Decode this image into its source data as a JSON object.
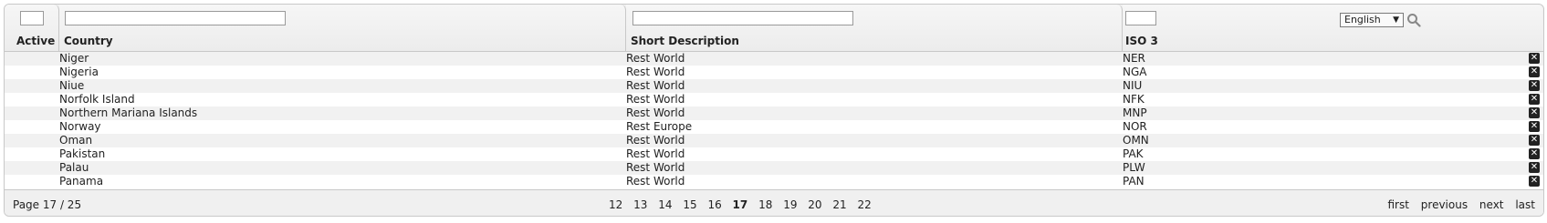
{
  "header": {
    "columns": {
      "active": "Active",
      "country": "Country",
      "short_description": "Short Description",
      "iso3": "ISO 3"
    },
    "language": "English"
  },
  "rows": [
    {
      "country": "Niger",
      "short_description": "Rest World",
      "iso3": "NER"
    },
    {
      "country": "Nigeria",
      "short_description": "Rest World",
      "iso3": "NGA"
    },
    {
      "country": "Niue",
      "short_description": "Rest World",
      "iso3": "NIU"
    },
    {
      "country": "Norfolk Island",
      "short_description": "Rest World",
      "iso3": "NFK"
    },
    {
      "country": "Northern Mariana Islands",
      "short_description": "Rest World",
      "iso3": "MNP"
    },
    {
      "country": "Norway",
      "short_description": "Rest Europe",
      "iso3": "NOR"
    },
    {
      "country": "Oman",
      "short_description": "Rest World",
      "iso3": "OMN"
    },
    {
      "country": "Pakistan",
      "short_description": "Rest World",
      "iso3": "PAK"
    },
    {
      "country": "Palau",
      "short_description": "Rest World",
      "iso3": "PLW"
    },
    {
      "country": "Panama",
      "short_description": "Rest World",
      "iso3": "PAN"
    }
  ],
  "footer": {
    "page_info": "Page 17 / 25",
    "pages": [
      "12",
      "13",
      "14",
      "15",
      "16",
      "17",
      "18",
      "19",
      "20",
      "21",
      "22"
    ],
    "current_page": "17",
    "nav": {
      "first": "first",
      "previous": "previous",
      "next": "next",
      "last": "last"
    }
  },
  "icons": {
    "delete": "close-box-icon",
    "search": "search-icon",
    "dropdown": "chevron-down-icon"
  }
}
